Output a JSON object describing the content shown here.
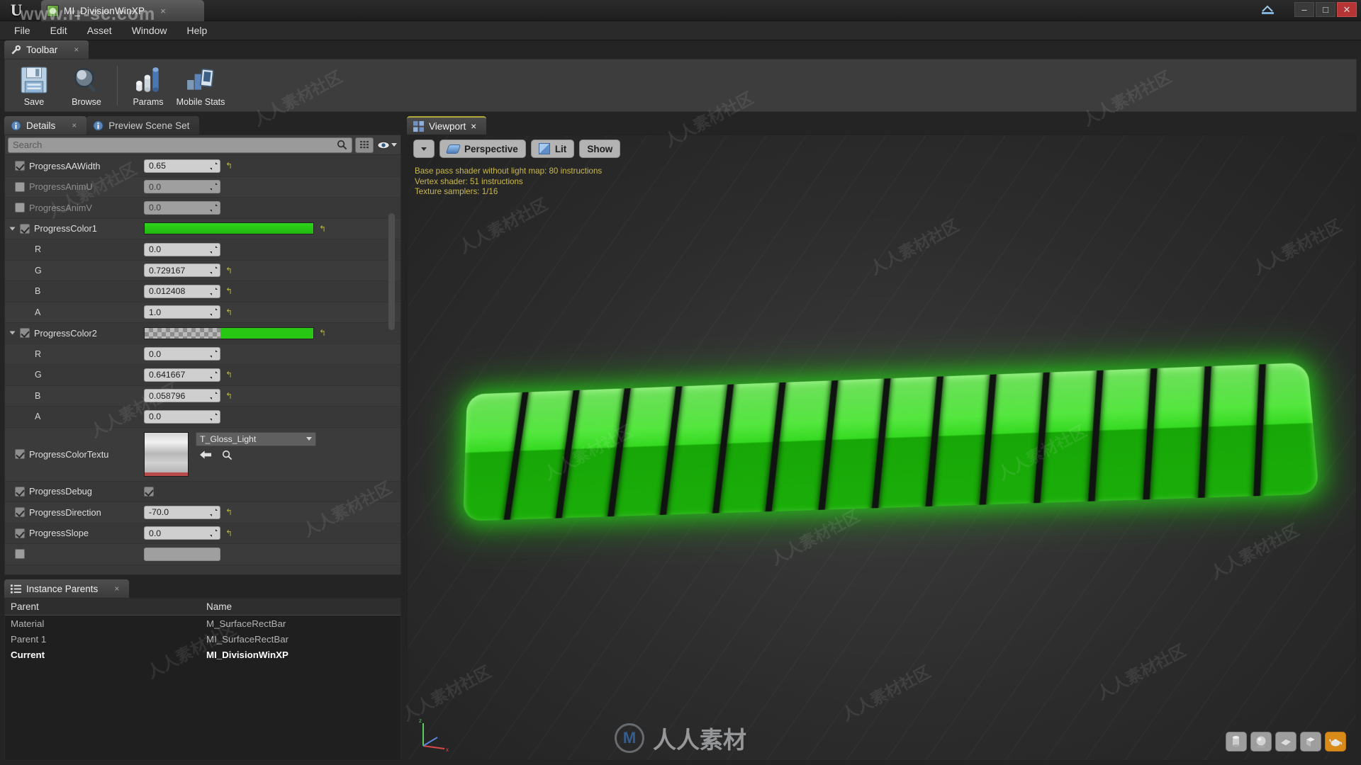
{
  "window": {
    "app_logo": "unreal-logo",
    "tab_title": "MI_DivisionWinXP",
    "tab_close": "×",
    "minimize": "–",
    "maximize": "□",
    "close": "✕"
  },
  "menubar": {
    "items": [
      {
        "label": "File"
      },
      {
        "label": "Edit"
      },
      {
        "label": "Asset"
      },
      {
        "label": "Window"
      },
      {
        "label": "Help"
      }
    ]
  },
  "toolbar": {
    "tab_label": "Toolbar",
    "tab_close": "×",
    "buttons": [
      {
        "label": "Save",
        "icon": "save-icon"
      },
      {
        "label": "Browse",
        "icon": "magnifier-icon"
      },
      {
        "label": "Params",
        "icon": "params-icon"
      },
      {
        "label": "Mobile Stats",
        "icon": "mobile-stats-icon"
      }
    ]
  },
  "details": {
    "tab_label": "Details",
    "tab_close": "×",
    "sibling_tab_label": "Preview Scene Set",
    "search_placeholder": "Search",
    "view_grid_icon": "grid-view-icon",
    "eye_icon": "visibility-icon",
    "rows": [
      {
        "name": "ProgressAAWidth",
        "kind": "number",
        "value": "0.65",
        "checked": true,
        "enabled": true,
        "revert": true
      },
      {
        "name": "ProgressAnimU",
        "kind": "number",
        "value": "0.0",
        "checked": false,
        "enabled": false,
        "revert": false
      },
      {
        "name": "ProgressAnimV",
        "kind": "number",
        "value": "0.0",
        "checked": false,
        "enabled": false,
        "revert": false
      },
      {
        "name": "ProgressColor1",
        "kind": "color",
        "swatch": "green",
        "checked": true,
        "enabled": true,
        "expandable": true
      },
      {
        "name": "R",
        "kind": "number",
        "value": "0.0",
        "sub": true,
        "revert": false
      },
      {
        "name": "G",
        "kind": "number",
        "value": "0.729167",
        "sub": true,
        "revert": true
      },
      {
        "name": "B",
        "kind": "number",
        "value": "0.012408",
        "sub": true,
        "revert": true
      },
      {
        "name": "A",
        "kind": "number",
        "value": "1.0",
        "sub": true,
        "revert": true
      },
      {
        "name": "ProgressColor2",
        "kind": "color",
        "swatch": "alpha-green",
        "checked": true,
        "enabled": true,
        "expandable": true
      },
      {
        "name": "R",
        "kind": "number",
        "value": "0.0",
        "sub": true,
        "revert": false
      },
      {
        "name": "G",
        "kind": "number",
        "value": "0.641667",
        "sub": true,
        "revert": true
      },
      {
        "name": "B",
        "kind": "number",
        "value": "0.058796",
        "sub": true,
        "revert": true
      },
      {
        "name": "A",
        "kind": "number",
        "value": "0.0",
        "sub": true,
        "revert": false
      },
      {
        "name": "ProgressColorTextu",
        "kind": "texture",
        "value": "T_Gloss_Light",
        "checked": true,
        "enabled": true
      },
      {
        "name": "ProgressDebug",
        "kind": "bool",
        "value": true,
        "checked": true,
        "enabled": true
      },
      {
        "name": "ProgressDirection",
        "kind": "number",
        "value": "-70.0",
        "checked": true,
        "enabled": true,
        "revert": true
      },
      {
        "name": "ProgressSlope",
        "kind": "number",
        "value": "0.0",
        "checked": true,
        "enabled": true,
        "revert": true
      }
    ],
    "texture_back_icon": "back-arrow-icon",
    "texture_find_icon": "browse-magnifier-icon"
  },
  "instance_parents": {
    "tab_label": "Instance Parents",
    "tab_close": "×",
    "columns": [
      "Parent",
      "Name"
    ],
    "rows": [
      {
        "parent": "Material",
        "name": "M_SurfaceRectBar",
        "current": false
      },
      {
        "parent": "Parent 1",
        "name": "MI_SurfaceRectBar",
        "current": false
      },
      {
        "parent": "Current",
        "name": "MI_DivisionWinXP",
        "current": true
      }
    ]
  },
  "viewport": {
    "tab_label": "Viewport",
    "tab_close": "×",
    "toolbar": {
      "caret": "▼",
      "perspective_label": "Perspective",
      "lit_label": "Lit",
      "show_label": "Show"
    },
    "stats": [
      "Base pass shader without light map: 80 instructions",
      "Vertex shader: 51 instructions",
      "Texture samplers: 1/16"
    ],
    "stats_color": "#c9b84f",
    "segments": 16,
    "bar_color": "#25c414",
    "shape_buttons": [
      {
        "icon": "cylinder-icon",
        "active": false
      },
      {
        "icon": "sphere-icon",
        "active": false
      },
      {
        "icon": "plane-icon",
        "active": false
      },
      {
        "icon": "cube-icon",
        "active": false
      },
      {
        "icon": "teapot-icon",
        "active": true
      }
    ]
  },
  "watermark": {
    "top_text": "www.rr-sc.com",
    "brand_text": "人人素材",
    "tile_text": "人人素材社区"
  }
}
